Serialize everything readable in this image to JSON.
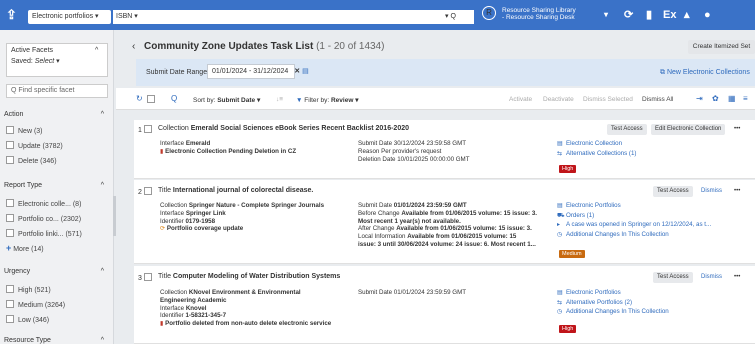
{
  "topbar": {
    "logo": "⇪",
    "scope": "Electronic portfolios ▾",
    "search_type": "ISBN ▾",
    "search_button": "▾ Q",
    "library_line1": "Resource Sharing Library",
    "library_line2": "- Resource Sharing Desk",
    "library_caret": "▾"
  },
  "left": {
    "active_facets": "Active Facets",
    "saved_label": "Saved:",
    "saved_value": "Select",
    "find_placeholder": "Q  Find specific facet",
    "action": {
      "title": "Action",
      "items": [
        "New (3)",
        "Update (3782)",
        "Delete (346)"
      ]
    },
    "report_type": {
      "title": "Report Type",
      "items": [
        "Electronic colle... (8)",
        "Portfolio co... (2302)",
        "Portfolio linki... (571)"
      ],
      "more": "More (14)"
    },
    "urgency": {
      "title": "Urgency",
      "items": [
        "High (521)",
        "Medium (3264)",
        "Low (346)"
      ]
    },
    "resource_type": {
      "title": "Resource Type"
    }
  },
  "header": {
    "title": "Community Zone Updates Task List",
    "count": "(1 - 20 of 1434)",
    "create": "Create Itemized Set"
  },
  "datebar": {
    "label": "Submit Date Range",
    "value": "01/01/2024 - 31/12/2024",
    "new_collections": "New Electronic Collections"
  },
  "toolbar": {
    "sort_by": "Sort by:",
    "sort_value": "Submit Date ▾",
    "filter_by": "Filter by:",
    "filter_value": "Review ▾",
    "activate": "Activate",
    "deactivate": "Deactivate",
    "dismiss_selected": "Dismiss Selected",
    "dismiss_all": "Dismiss All"
  },
  "rows": [
    {
      "num": "1",
      "type": "Collection",
      "title": "Emerald Social Sciences eBook Series Recent Backlist 2016-2020",
      "buttons": [
        "Test Access",
        "Edit Electronic Collection",
        "•••"
      ],
      "fields": [
        [
          "Interface",
          "Emerald"
        ]
      ],
      "warning": "Electronic Collection Pending Deletion in CZ",
      "mid": [
        [
          "Submit Date",
          "30/12/2024 23:59:58 GMT"
        ],
        [
          "Reason",
          "Per provider's request"
        ],
        [
          "Deletion Date",
          "10/01/2025 00:00:00 GMT"
        ]
      ],
      "links": [
        "Electronic Collection",
        "Alternative Collections (1)"
      ],
      "badge": "High"
    },
    {
      "num": "2",
      "type": "Title",
      "title": "International journal of colorectal disease.",
      "buttons": [
        "Test Access",
        "Dismiss",
        "•••"
      ],
      "fields": [
        [
          "Collection",
          "Springer Nature - Complete Springer Journals"
        ],
        [
          "Interface",
          "Springer Link"
        ],
        [
          "Identifier",
          "0179-1958"
        ]
      ],
      "warning": "Portfolio coverage update",
      "mid": [
        [
          "Submit Date",
          "01/01/2024 23:59:59 GMT"
        ],
        [
          "Before Change",
          "Available from 01/06/2015 volume: 15 issue: 3."
        ],
        [
          "",
          "Most recent 1 year(s) not available."
        ],
        [
          "After Change",
          "Available from 01/06/2015 volume: 15 issue: 3."
        ],
        [
          "Local Information",
          "Available from 01/06/2015 volume: 15"
        ],
        [
          "",
          "issue: 3 until 30/06/2024 volume: 24 issue: 6. Most recent 1..."
        ]
      ],
      "links": [
        "Electronic Portfolios",
        "Orders (1)",
        "A case was opened in Springer on 12/12/2024, as t...",
        "Additional Changes In This Collection"
      ],
      "badge": "Medium"
    },
    {
      "num": "3",
      "type": "Title",
      "title": "Computer Modeling of Water Distribution Systems",
      "buttons": [
        "Test Access",
        "Dismiss",
        "•••"
      ],
      "fields": [
        [
          "Collection",
          "KNovel Environment & Environmental"
        ],
        [
          "",
          "Engineering Academic"
        ],
        [
          "Interface",
          "Knovel"
        ],
        [
          "Identifier",
          "1-58321-345-7"
        ]
      ],
      "warning": "Portfolio deleted from non-auto delete electronic service",
      "mid": [
        [
          "Submit Date",
          "01/01/2024 23:59:59 GMT"
        ]
      ],
      "links": [
        "Electronic Portfolios",
        "Alternative Portfolios (2)",
        "Additional Changes In This Collection"
      ],
      "badge": "High"
    }
  ]
}
